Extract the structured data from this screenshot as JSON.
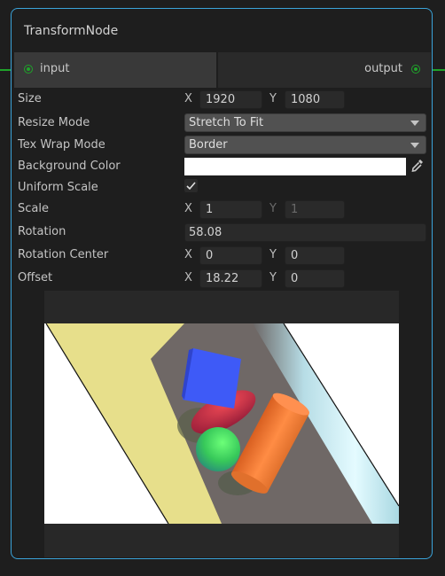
{
  "node": {
    "title": "TransformNode",
    "input_port": "input",
    "output_port": "output",
    "accent_color": "#3aa3d9",
    "port_color": "#1fa32a"
  },
  "fields": {
    "size": {
      "label": "Size",
      "x_label": "X",
      "x": "1920",
      "y_label": "Y",
      "y": "1080"
    },
    "resize_mode": {
      "label": "Resize Mode",
      "value": "Stretch To Fit"
    },
    "tex_wrap_mode": {
      "label": "Tex Wrap Mode",
      "value": "Border"
    },
    "background_color": {
      "label": "Background Color",
      "value": "#ffffff"
    },
    "uniform_scale": {
      "label": "Uniform Scale",
      "checked": true,
      "check_glyph": "✓"
    },
    "scale": {
      "label": "Scale",
      "x_label": "X",
      "x": "1",
      "y_label": "Y",
      "y": "1"
    },
    "rotation": {
      "label": "Rotation",
      "value": "58.08"
    },
    "rotation_center": {
      "label": "Rotation Center",
      "x_label": "X",
      "x": "0",
      "y_label": "Y",
      "y": "0"
    },
    "offset": {
      "label": "Offset",
      "x_label": "X",
      "x": "18.22",
      "y_label": "Y",
      "y": "0"
    }
  },
  "preview": {
    "description": "Rotated 3D scene preview: yellow plane, blue cube, red capsule, green sphere, orange cylinder, light-blue bar"
  }
}
